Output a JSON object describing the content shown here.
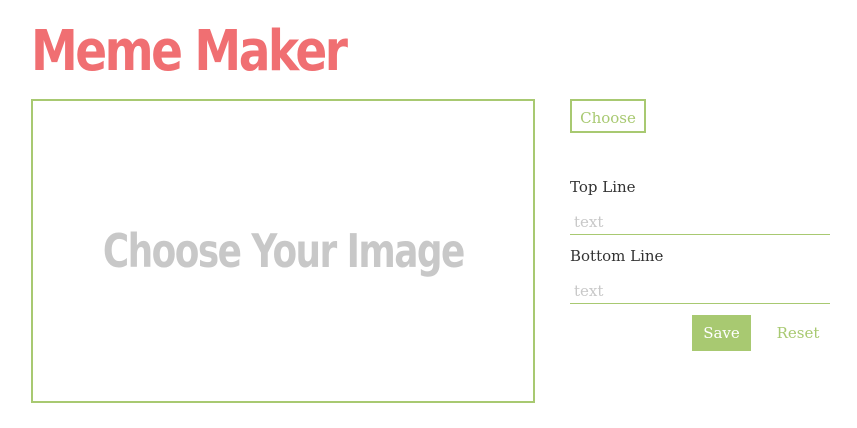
{
  "app": {
    "title": "Meme Maker"
  },
  "canvas": {
    "placeholder": "Choose Your Image"
  },
  "controls": {
    "choose_label": "Choose",
    "top_line_label": "Top Line",
    "top_line_value": "",
    "top_line_placeholder": "text",
    "bottom_line_label": "Bottom Line",
    "bottom_line_value": "",
    "bottom_line_placeholder": "text",
    "save_label": "Save",
    "reset_label": "Reset"
  },
  "colors": {
    "title": "#f06f72",
    "accent": "#a8c971",
    "placeholder_text": "#c8c8c8",
    "label_text": "#333333"
  }
}
